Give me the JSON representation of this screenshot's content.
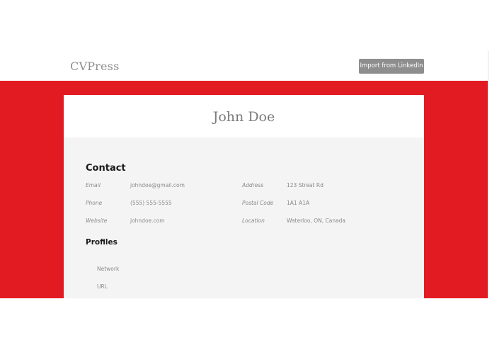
{
  "header": {
    "brand": "CVPress",
    "import_button": "Import from LinkedIn"
  },
  "resume": {
    "name": "John Doe",
    "contact": {
      "title": "Contact",
      "email": {
        "label": "Email",
        "value": "johndoe@gmail.com"
      },
      "phone": {
        "label": "Phone",
        "value": "(555) 555-5555"
      },
      "website": {
        "label": "Website",
        "value": "johndoe.com"
      },
      "address": {
        "label": "Address",
        "value": "123 Streat Rd"
      },
      "postal": {
        "label": "Postal Code",
        "value": "1A1 A1A"
      },
      "location": {
        "label": "Location",
        "value": "Waterloo, ON, Canada"
      }
    },
    "profiles": {
      "title": "Profiles",
      "network_label": "Network",
      "url_label": "URL"
    }
  },
  "colors": {
    "accent": "#e21b23",
    "card_background": "#f4f4f4",
    "button_background": "#8e8e8e"
  }
}
